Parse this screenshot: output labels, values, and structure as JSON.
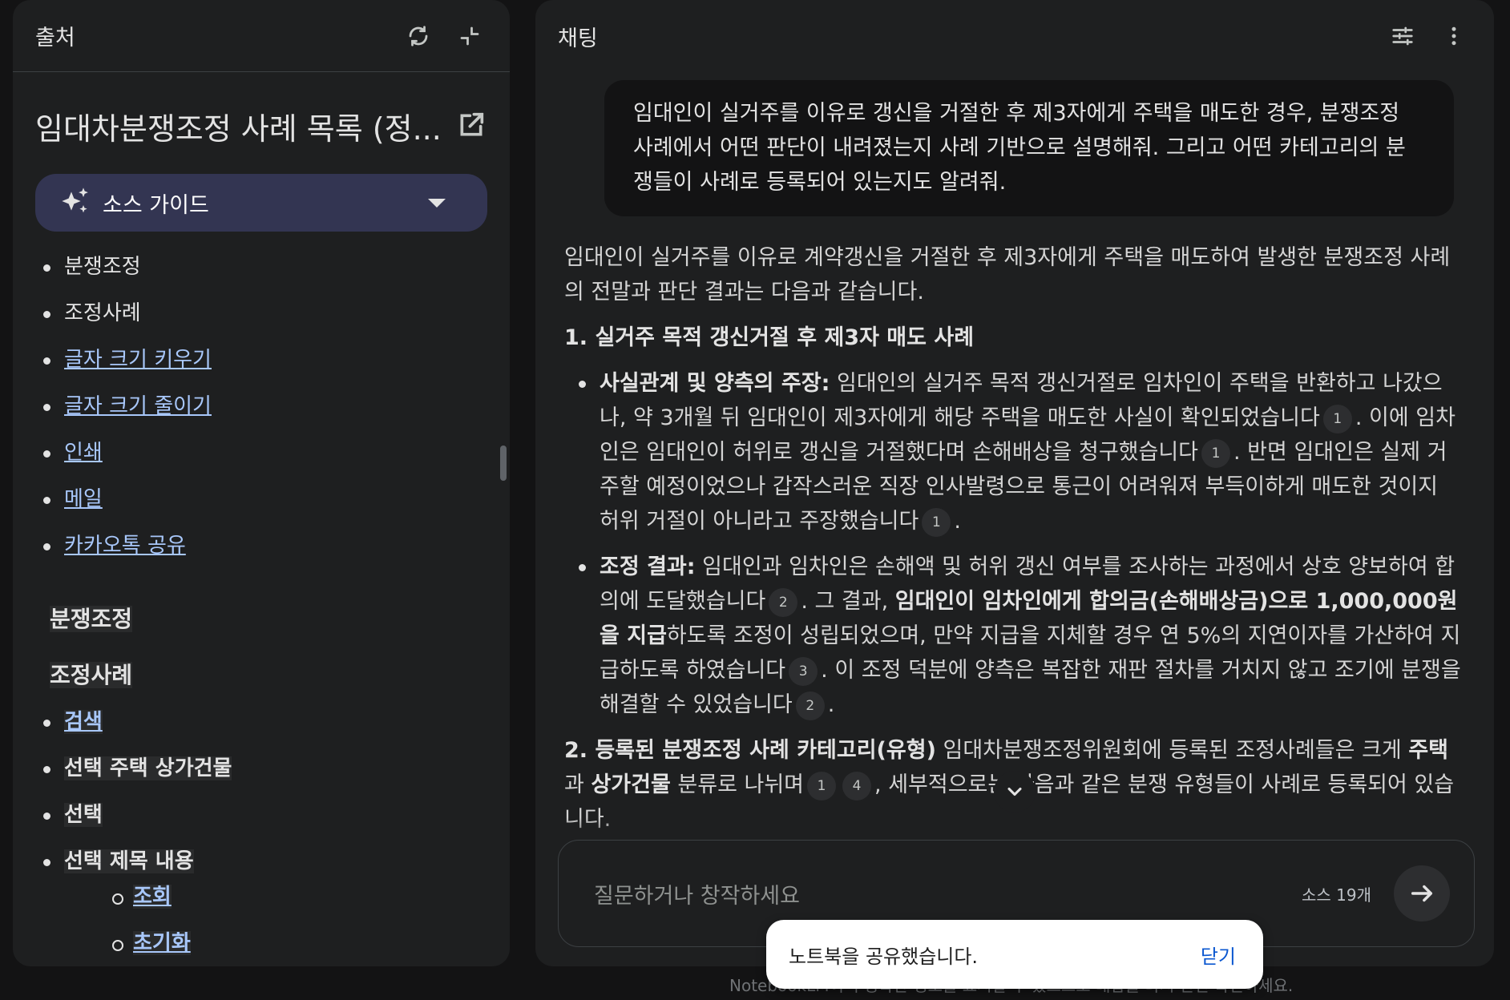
{
  "left": {
    "header_title": "출처",
    "doc_title": "임대차분쟁조정 사례 목록 (정...",
    "guide_label": "소스 가이드",
    "items": [
      {
        "text": "분쟁조정",
        "link": false
      },
      {
        "text": "조정사례",
        "link": false
      },
      {
        "text": "글자 크기 키우기",
        "link": true
      },
      {
        "text": "글자 크기 줄이기",
        "link": true
      },
      {
        "text": "인쇄",
        "link": true
      },
      {
        "text": "메일",
        "link": true
      },
      {
        "text": "카카오톡 공유",
        "link": true
      }
    ],
    "section1": "분쟁조정",
    "section2": "조정사례",
    "bold_items": [
      "검색",
      "선택 주택 상가건물",
      "선택",
      "선택 제목 내용"
    ],
    "sub_items": [
      "조회",
      "초기화"
    ]
  },
  "right": {
    "header_title": "채팅",
    "user_query": "임대인이 실거주를 이유로 갱신을 거절한 후 제3자에게 주택을 매도한 경우, 분쟁조정 사례에서 어떤 판단이 내려졌는지 사례 기반으로 설명해줘. 그리고 어떤 카테고리의 분쟁들이 사례로 등록되어 있는지도 알려줘.",
    "intro": "임대인이 실거주를 이유로 계약갱신을 거절한 후 제3자에게 주택을 매도하여 발생한 분쟁조정 사례의 전말과 판단 결과는 다음과 같습니다.",
    "h1": "1. 실거주 목적 갱신거절 후 제3자 매도 사례",
    "b1_label": "사실관계 및 양측의 주장:",
    "b1_t1": " 임대인의 실거주 목적 갱신거절로 임차인이 주택을 반환하고 나갔으나, 약 3개월 뒤 임대인이 제3자에게 해당 주택을 매도한 사실이 확인되었습니다",
    "b1_t2": ". 이에 임차인은 임대인이 허위로 갱신을 거절했다며 손해배상을 청구했습니다",
    "b1_t3": ". 반면 임대인은 실제 거주할 예정이었으나 갑작스러운 직장 인사발령으로 통근이 어려워져 부득이하게 매도한 것이지 허위 거절이 아니라고 주장했습니다",
    "b1_t4": ".",
    "b2_label": "조정 결과:",
    "b2_t1": " 임대인과 임차인은 손해액 및 허위 갱신 여부를 조사하는 과정에서 상호 양보하여 합의에 도달했습니다",
    "b2_t2": ". 그 결과, ",
    "b2_bold": "임대인이 임차인에게 합의금(손해배상금)으로 1,000,000원을 지급",
    "b2_t3": "하도록 조정이 성립되었으며, 만약 지급을 지체할 경우 연 5%의 지연이자를 가산하여 지급하도록 하였습니다",
    "b2_t4": ". 이 조정 덕분에 양측은 복잡한 재판 절차를 거치지 않고 조기에 분쟁을 해결할 수 있었습니다",
    "b2_t5": ".",
    "h2": "2. 등록된 분쟁조정 사례 카테고리(유형)",
    "p2_t1": " 임대차분쟁조정위원회에 등록된 조정사례들은 크게 ",
    "p2_b1": "주택",
    "p2_t2": "과 ",
    "p2_b2": "상가건물",
    "p2_t3": " 분류로 나뉘며",
    "p2_t4": ", 세부적으로는 다음과 같은 분쟁 유형들이 사례로 등록되어 있습니다.",
    "cites": [
      "1",
      "1",
      "1",
      "2",
      "3",
      "2",
      "1",
      "4"
    ],
    "composer_placeholder": "질문하거나 창작하세요",
    "source_count": "소스 19개",
    "footer": "NotebookLM이 부정확한 정보를 표시할 수 있으므로 대답을 다시 한번 확인하세요."
  },
  "toast": {
    "message": "노트북을 공유했습니다.",
    "close_label": "닫기"
  },
  "icons": {
    "refresh": "refresh-icon",
    "collapse": "collapse-icon",
    "external": "open-in-new-icon",
    "spark": "sparkle-icon",
    "tune": "tune-icon",
    "more": "more-vert-icon",
    "send": "arrow-forward-icon",
    "down": "chevron-down-icon"
  }
}
